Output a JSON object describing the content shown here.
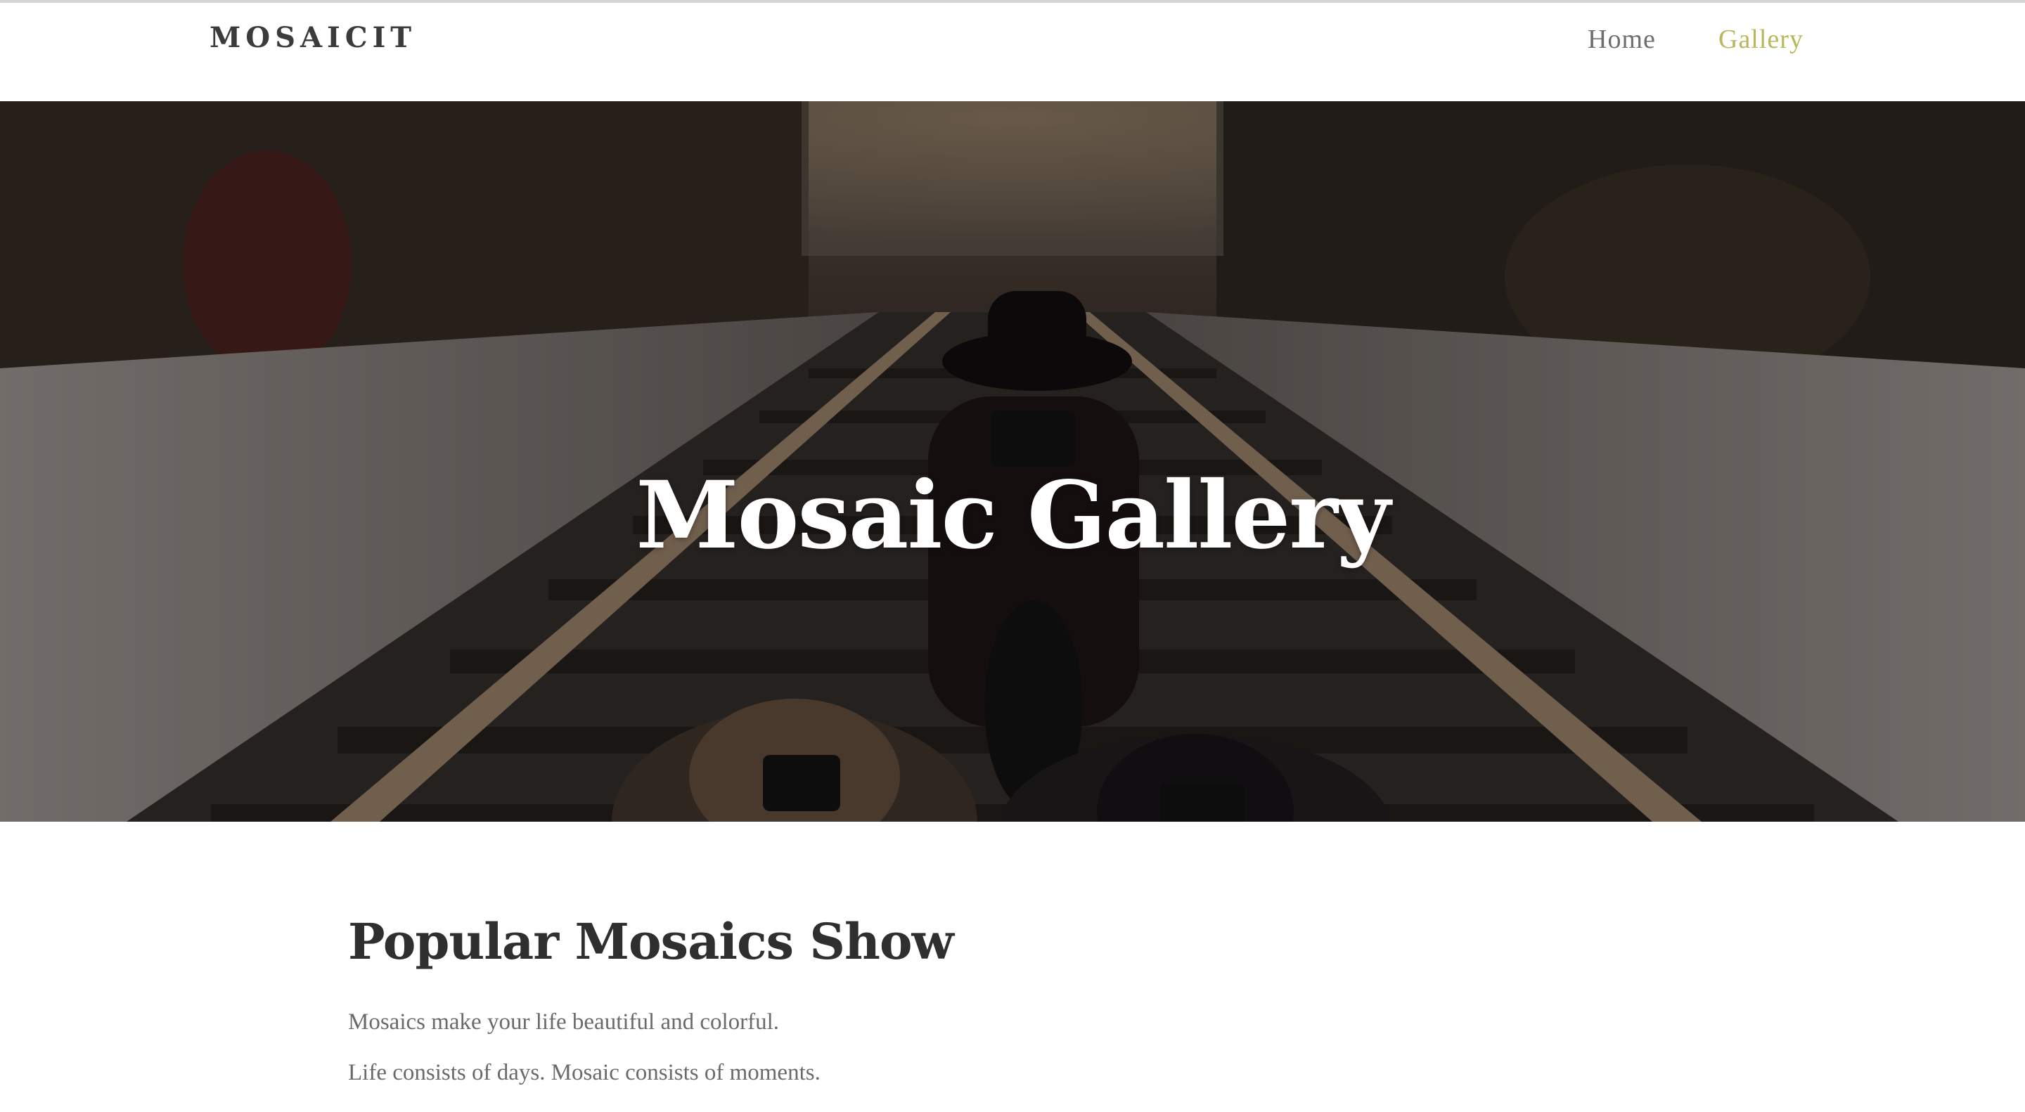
{
  "brand": "MOSAICIT",
  "nav": {
    "home": "Home",
    "gallery": "Gallery",
    "active_color": "#b7b85b"
  },
  "hero": {
    "title": "Mosaic Gallery"
  },
  "section": {
    "title": "Popular Mosaics Show",
    "paragraphs": [
      "Mosaics make your life beautiful and colorful.",
      "Life consists of days. Mosaic consists of moments."
    ]
  }
}
